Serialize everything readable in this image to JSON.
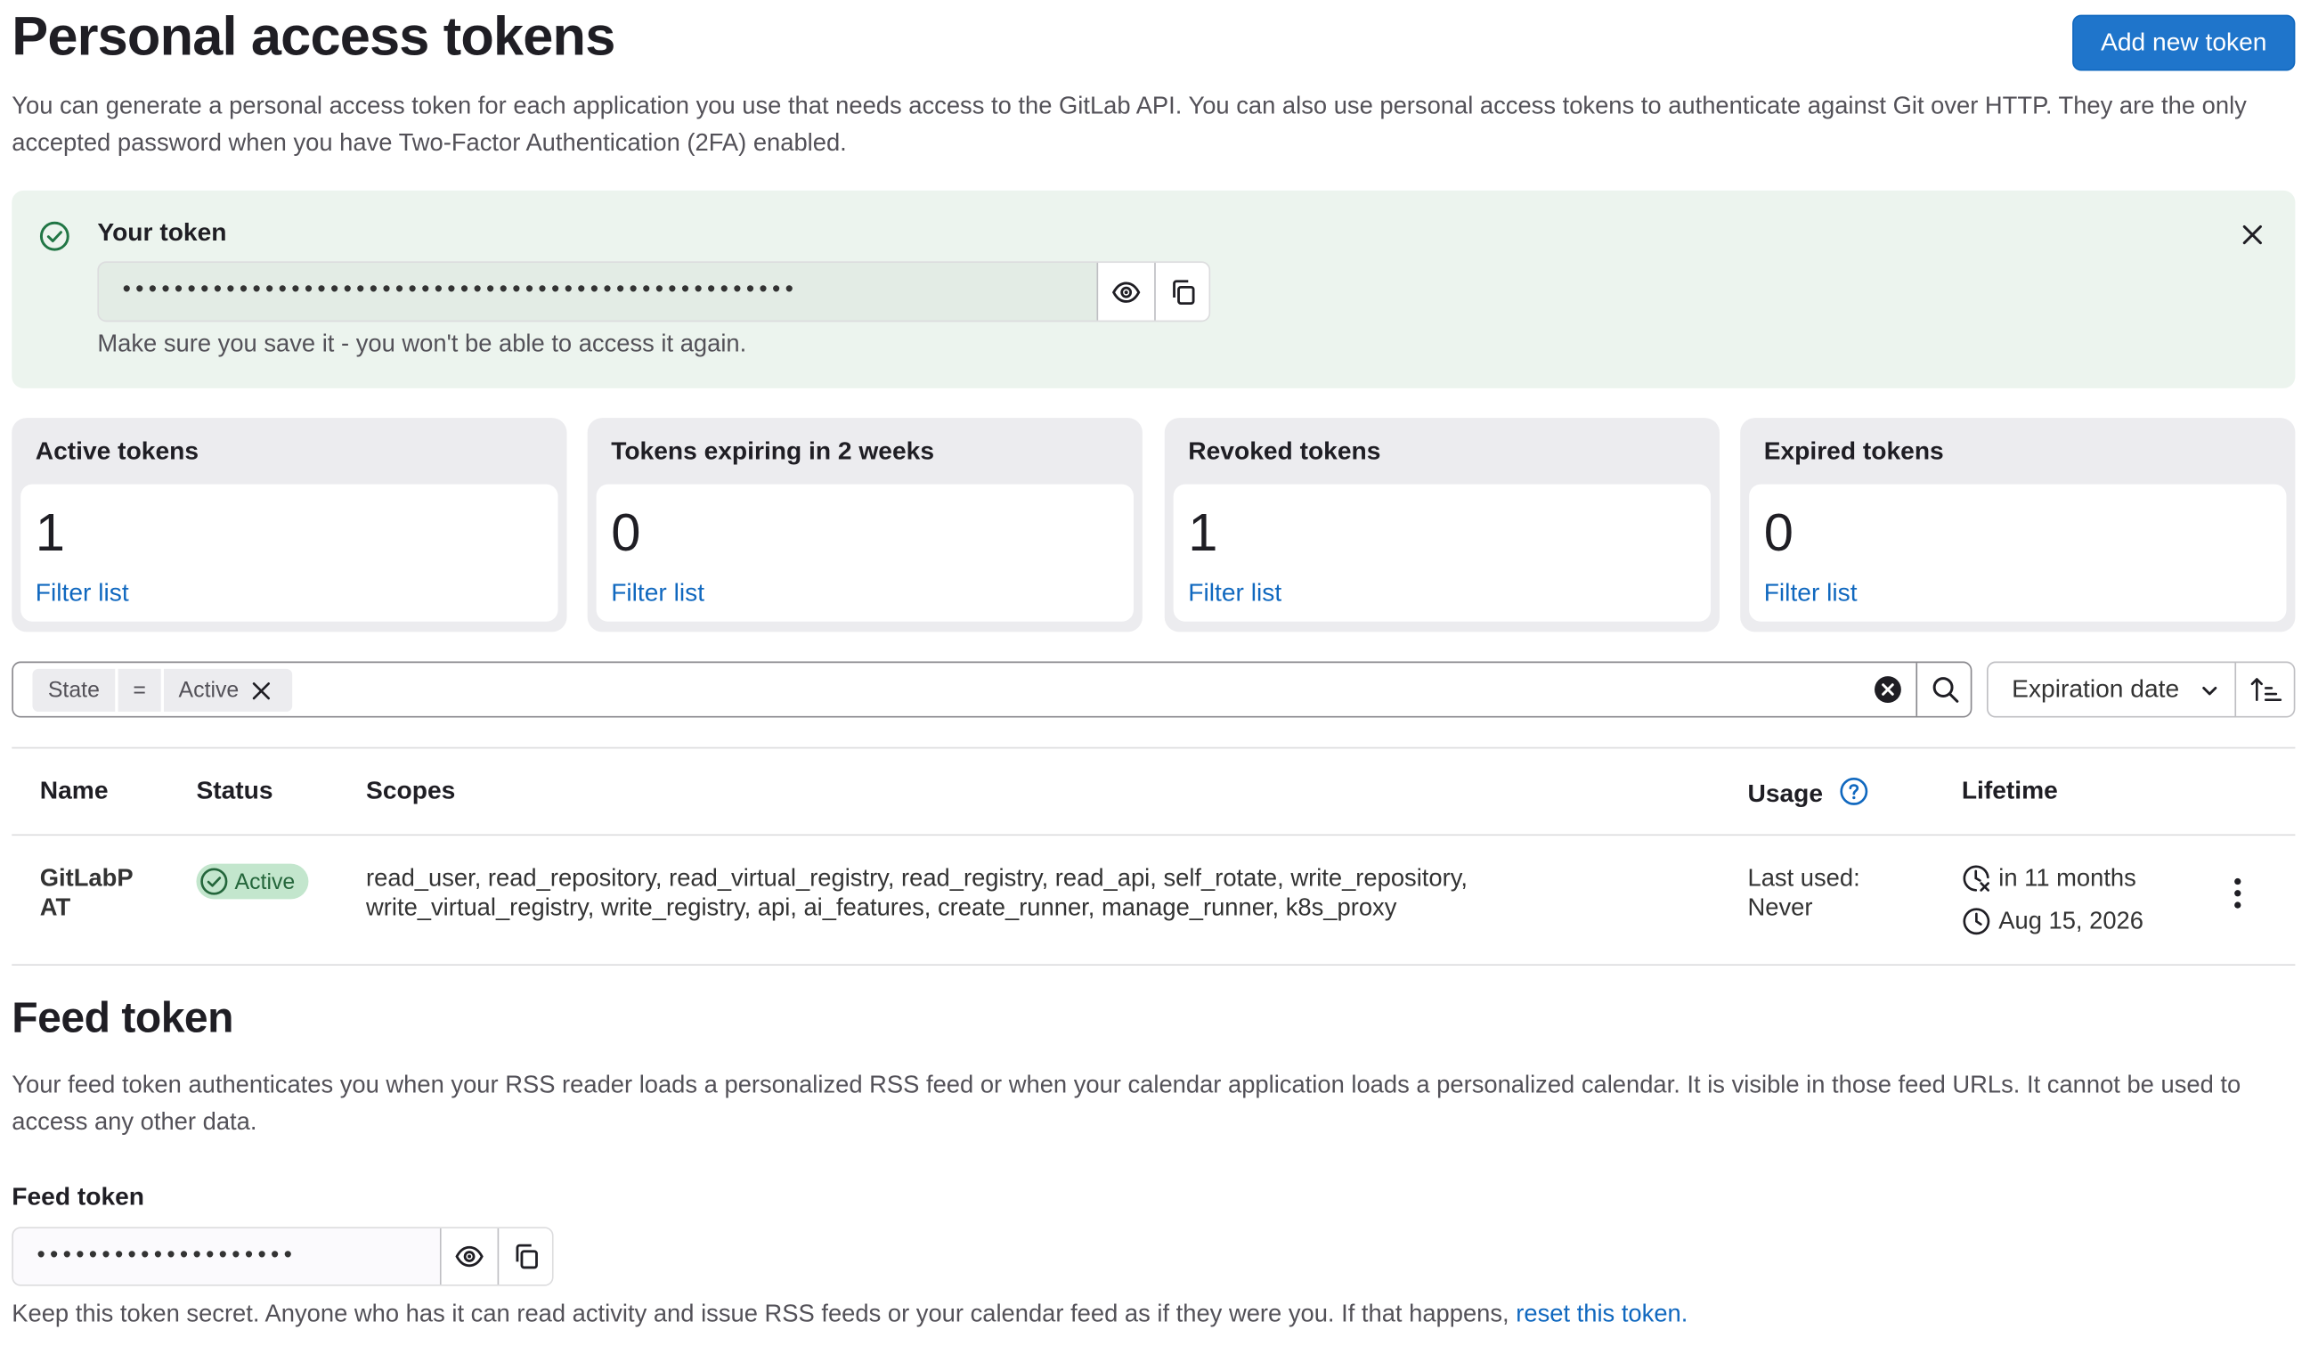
{
  "header": {
    "title": "Personal access tokens",
    "add_button": "Add new token",
    "description": "You can generate a personal access token for each application you use that needs access to the GitLab API. You can also use personal access tokens to authenticate against Git over HTTP. They are the only accepted password when you have Two-Factor Authentication (2FA) enabled."
  },
  "alert": {
    "title": "Your token",
    "token_masked": "••••••••••••••••••••••••••••••••••••••••••••••••••••",
    "hint": "Make sure you save it - you won't be able to access it again."
  },
  "stats": [
    {
      "label": "Active tokens",
      "value": "1",
      "link": "Filter list"
    },
    {
      "label": "Tokens expiring in 2 weeks",
      "value": "0",
      "link": "Filter list"
    },
    {
      "label": "Revoked tokens",
      "value": "1",
      "link": "Filter list"
    },
    {
      "label": "Expired tokens",
      "value": "0",
      "link": "Filter list"
    }
  ],
  "filter": {
    "token_key": "State",
    "operator": "=",
    "token_value": "Active",
    "sort_label": "Expiration date"
  },
  "table": {
    "headers": {
      "name": "Name",
      "status": "Status",
      "scopes": "Scopes",
      "usage": "Usage",
      "lifetime": "Lifetime"
    },
    "rows": [
      {
        "name_line1": "GitLabP",
        "name_line2": "AT",
        "status": "Active",
        "scopes_line1": "read_user, read_repository, read_virtual_registry, read_registry, read_api, self_rotate, write_repository,",
        "scopes_line2": "write_virtual_registry, write_registry, api, ai_features, create_runner, manage_runner, k8s_proxy",
        "usage_line1": "Last used:",
        "usage_line2": "Never",
        "expires_in": "in 11 months",
        "expires_on": "Aug 15, 2026"
      }
    ]
  },
  "feed": {
    "title": "Feed token",
    "description": "Your feed token authenticates you when your RSS reader loads a personalized RSS feed or when your calendar application loads a personalized calendar. It is visible in those feed URLs. It cannot be used to access any other data.",
    "field_label": "Feed token",
    "token_masked": "••••••••••••••••••••",
    "note": "Keep this token secret. Anyone who has it can read activity and issue RSS feeds or your calendar feed as if they were you. If that happens,",
    "reset_link": "reset this token."
  },
  "colors": {
    "primary": "#1f75cb",
    "link": "#1068bf",
    "success_bg": "#ecf4ee",
    "badge_bg": "#c3e6cd",
    "badge_text": "#24663b"
  }
}
